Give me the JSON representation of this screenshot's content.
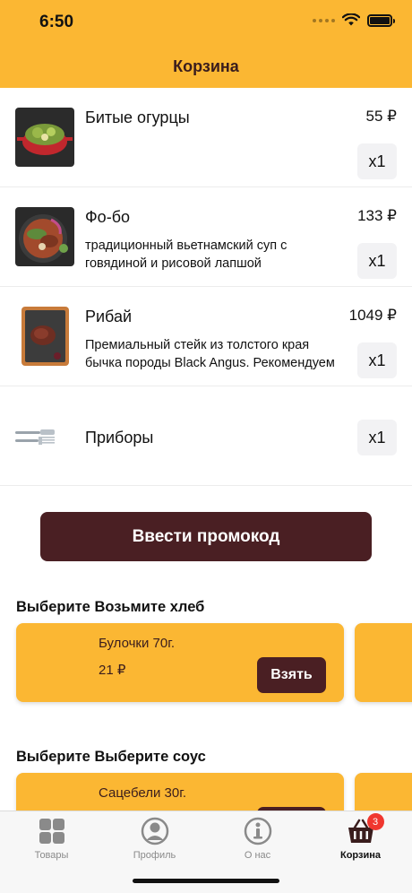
{
  "status_bar": {
    "time": "6:50"
  },
  "header": {
    "title": "Корзина"
  },
  "cart": {
    "items": [
      {
        "name": "Битые огурцы",
        "description": "",
        "price": "55 ₽",
        "quantity": "x1",
        "image": "cucumber-dish-image"
      },
      {
        "name": "Фо-бо",
        "description": "традиционный вьетнамский суп с говядиной и рисовой лапшой",
        "price": "133 ₽",
        "quantity": "x1",
        "image": "pho-bowl-image"
      },
      {
        "name": "Рибай",
        "description": "Премиальный стейк из толстого края бычка породы Black Angus. Рекомендуем",
        "price": "1049 ₽",
        "quantity": "x1",
        "image": "ribeye-steak-image"
      },
      {
        "name": "Приборы",
        "description": "",
        "price": "",
        "quantity": "x1",
        "image": "cutlery-icon"
      }
    ]
  },
  "promo_button": {
    "label": "Ввести промокод"
  },
  "upsell_sections": [
    {
      "title": "Выберите Возьмите хлеб",
      "product_name": "Булочки 70г.",
      "product_price": "21 ₽",
      "button_label": "Взять"
    },
    {
      "title": "Выберите Выберите соус",
      "product_name": "Сацебели 30г.",
      "product_price": "",
      "button_label": ""
    }
  ],
  "tabbar": {
    "tabs": [
      {
        "label": "Товары",
        "icon": "grid-icon",
        "active": false
      },
      {
        "label": "Профиль",
        "icon": "profile-icon",
        "active": false
      },
      {
        "label": "О нас",
        "icon": "info-icon",
        "active": false
      },
      {
        "label": "Корзина",
        "icon": "basket-icon",
        "active": true,
        "badge": "3"
      }
    ]
  },
  "colors": {
    "accent": "#fbb733",
    "brand_dark": "#4a1f23",
    "badge": "#f0372f"
  }
}
